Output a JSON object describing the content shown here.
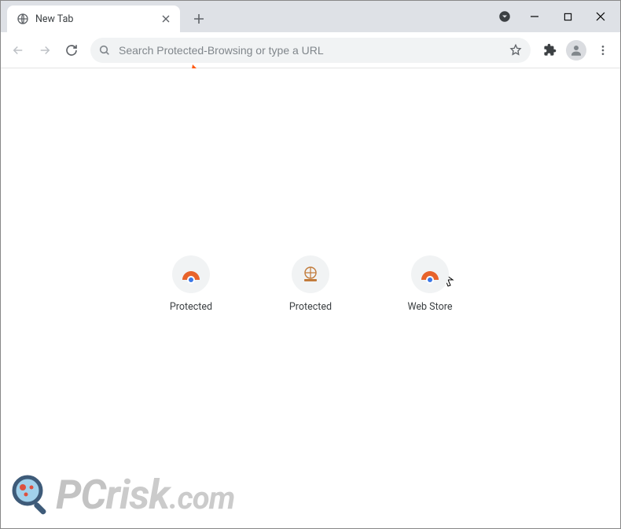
{
  "window": {
    "tab_title": "New Tab"
  },
  "toolbar": {
    "omnibox_placeholder": "Search Protected-Browsing or type a URL"
  },
  "shortcuts": [
    {
      "label": "Protected"
    },
    {
      "label": "Protected"
    },
    {
      "label": "Web Store"
    }
  ],
  "watermark": {
    "pc": "PC",
    "risk": "risk",
    "com": ".com"
  }
}
